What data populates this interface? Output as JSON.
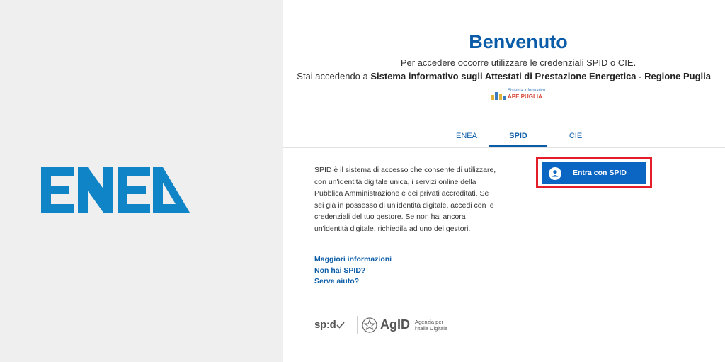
{
  "brand": {
    "logo_text": "ENEA",
    "color": "#0f84c6"
  },
  "welcome": {
    "title": "Benvenuto",
    "subtitle": "Per accedere occorre utilizzare le credenziali SPID o CIE.",
    "access_prefix": "Stai accedendo a ",
    "service_name": "Sistema informativo sugli Attestati di Prestazione Energetica - Regione Puglia"
  },
  "service_logo": {
    "small": "Sistema Informativo",
    "big": "APE PUGLIA"
  },
  "tabs": [
    {
      "label": "ENEA",
      "active": false
    },
    {
      "label": "SPID",
      "active": true
    },
    {
      "label": "CIE",
      "active": false
    }
  ],
  "spid": {
    "description": "SPID è il sistema di accesso che consente di utilizzare, con un'identità digitale unica, i servizi online della Pubblica Amministrazione e dei privati accreditati. Se sei già in possesso di un'identità digitale, accedi con le credenziali del tuo gestore. Se non hai ancora un'identità digitale, richiedila ad uno dei gestori.",
    "login_button": "Entra con SPID",
    "links": [
      "Maggiori informazioni",
      "Non hai SPID?",
      "Serve aiuto?"
    ]
  },
  "footer": {
    "spid_logo": "sp:d",
    "agid_logo": "AgID",
    "agid_text_1": "Agenzia per",
    "agid_text_2": "l'Italia Digitale"
  },
  "colors": {
    "accent": "#0a5ca8",
    "button": "#0a66c2",
    "highlight": "#e41d2b"
  }
}
